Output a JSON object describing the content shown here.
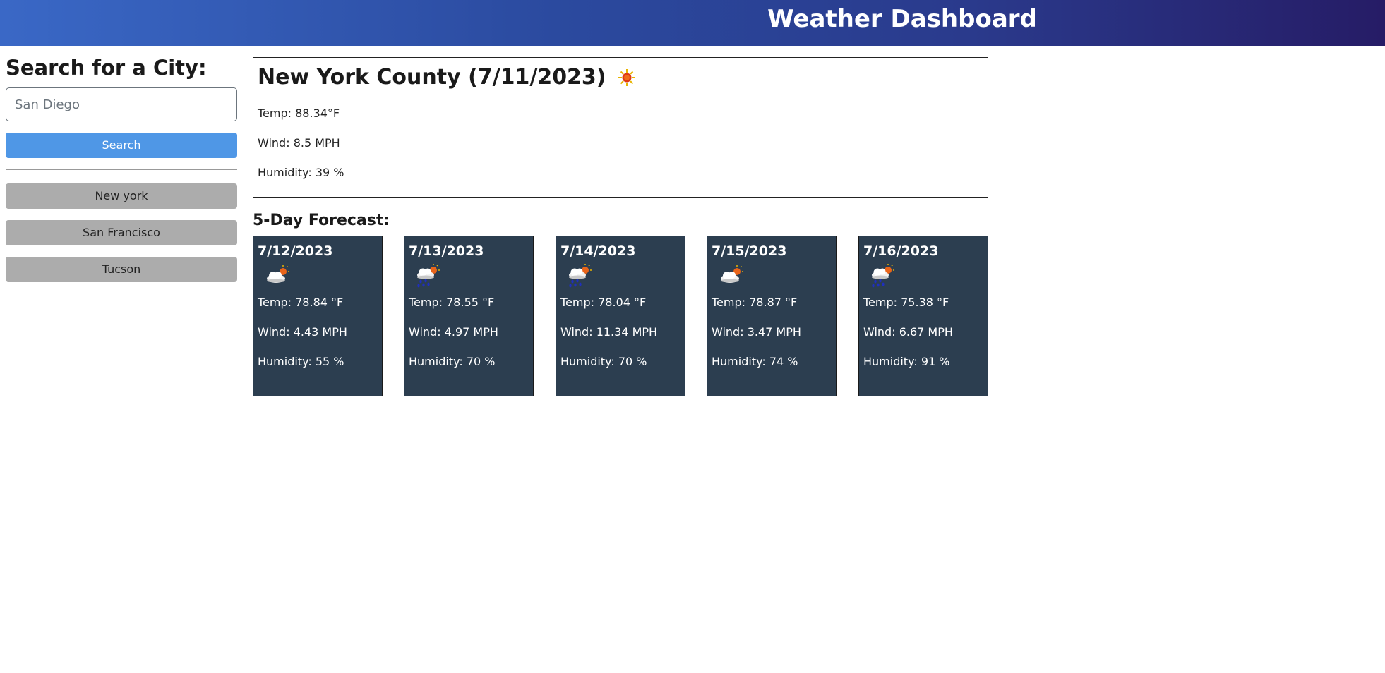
{
  "header": {
    "title": "Weather Dashboard"
  },
  "sidebar": {
    "heading": "Search for a City:",
    "search": {
      "value": "San Diego",
      "placeholder": "San Diego"
    },
    "search_button": "Search",
    "history": [
      {
        "label": "New york"
      },
      {
        "label": "San Francisco"
      },
      {
        "label": "Tucson"
      }
    ]
  },
  "current": {
    "title": "New York County (7/11/2023)",
    "icon": "sun-icon",
    "temp": "Temp: 88.34°F",
    "wind": "Wind: 8.5 MPH",
    "humidity": "Humidity: 39 %"
  },
  "forecast": {
    "title": "5-Day Forecast:",
    "days": [
      {
        "date": "7/12/2023",
        "icon": "partly-cloudy-icon",
        "temp": "Temp: 78.84 °F",
        "wind": "Wind: 4.43 MPH",
        "humidity": "Humidity: 55 %"
      },
      {
        "date": "7/13/2023",
        "icon": "rain-sun-icon",
        "temp": "Temp: 78.55 °F",
        "wind": "Wind: 4.97 MPH",
        "humidity": "Humidity: 70 %"
      },
      {
        "date": "7/14/2023",
        "icon": "rain-sun-icon",
        "temp": "Temp: 78.04 °F",
        "wind": "Wind: 11.34 MPH",
        "humidity": "Humidity: 70 %"
      },
      {
        "date": "7/15/2023",
        "icon": "partly-cloudy-icon",
        "temp": "Temp: 78.87 °F",
        "wind": "Wind: 3.47 MPH",
        "humidity": "Humidity: 74 %"
      },
      {
        "date": "7/16/2023",
        "icon": "rain-sun-icon",
        "temp": "Temp: 75.38 °F",
        "wind": "Wind: 6.67 MPH",
        "humidity": "Humidity: 91 %"
      }
    ]
  },
  "colors": {
    "header_start": "#3a68c6",
    "header_end": "#261c66",
    "search_button": "#4f97e6",
    "history_button": "#acacac",
    "card_bg": "#2c3e50"
  }
}
